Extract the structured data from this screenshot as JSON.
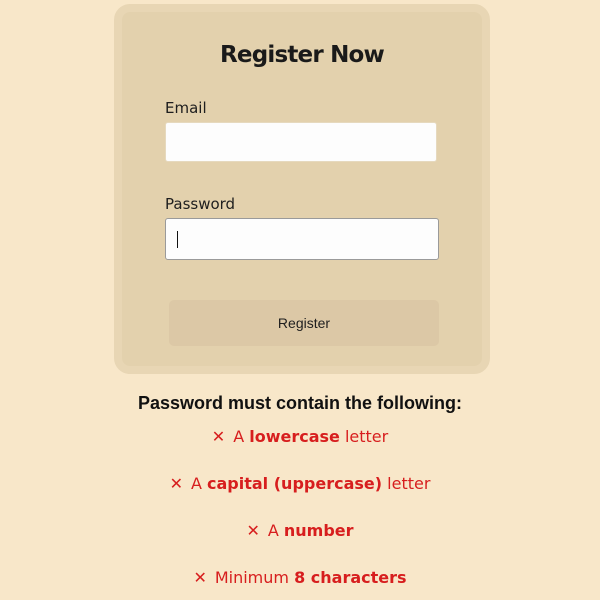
{
  "form": {
    "title": "Register Now",
    "email_label": "Email",
    "email_value": "",
    "password_label": "Password",
    "password_value": "",
    "register_label": "Register"
  },
  "requirements": {
    "heading": "Password must contain the following:",
    "invalid_mark": "✕",
    "items": [
      {
        "prefix": "A ",
        "bold": "lowercase",
        "suffix": " letter"
      },
      {
        "prefix": "A ",
        "bold": "capital (uppercase)",
        "suffix": " letter"
      },
      {
        "prefix": "A ",
        "bold": "number",
        "suffix": ""
      },
      {
        "prefix": "Minimum ",
        "bold": "8 characters",
        "suffix": ""
      }
    ]
  },
  "colors": {
    "page_background": "#f8e7c9",
    "card_background": "#e3d1ad",
    "invalid_red": "#d71e1e"
  }
}
